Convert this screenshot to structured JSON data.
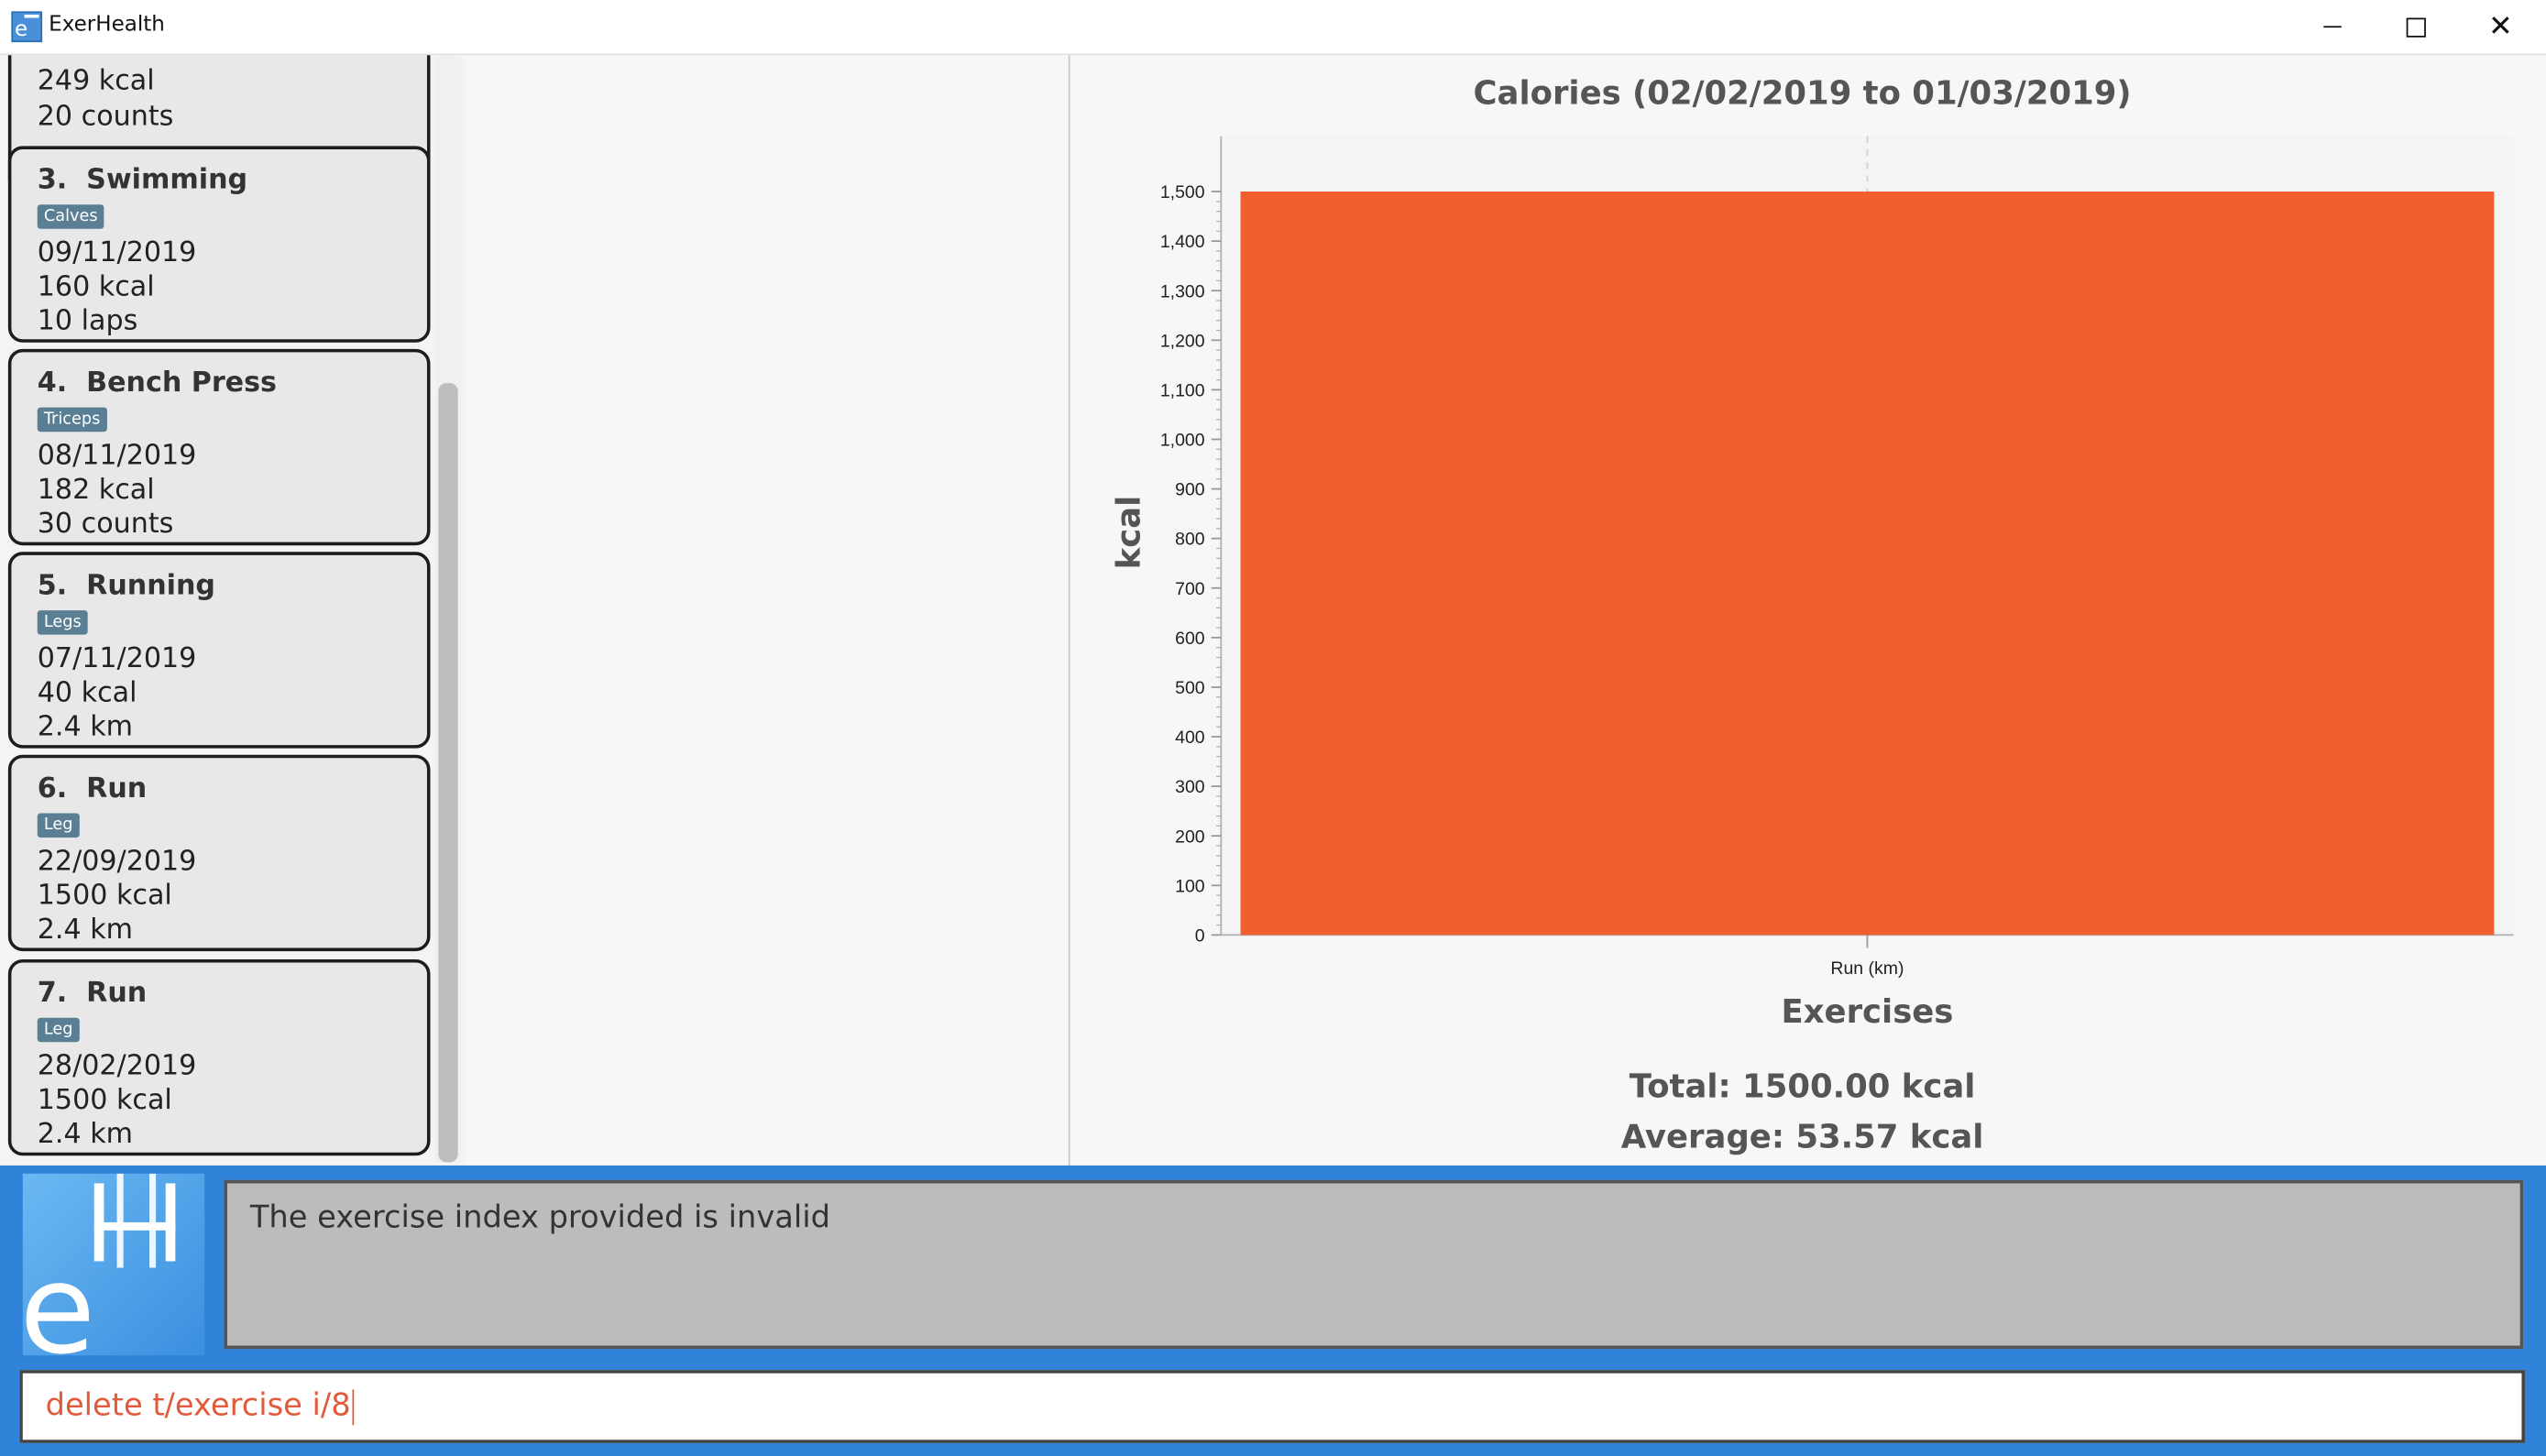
{
  "window": {
    "title": "ExerHealth"
  },
  "window_controls": {
    "minimize": "",
    "maximize": "",
    "close": "✕"
  },
  "exercise_list": {
    "partial_card": {
      "calories": "249 kcal",
      "quantity": "20 counts"
    },
    "items": [
      {
        "index": "3.",
        "name": "Swimming",
        "tag": "Calves",
        "date": "09/11/2019",
        "calories": "160 kcal",
        "quantity": "10 laps"
      },
      {
        "index": "4.",
        "name": "Bench Press",
        "tag": "Triceps",
        "date": "08/11/2019",
        "calories": "182 kcal",
        "quantity": "30 counts"
      },
      {
        "index": "5.",
        "name": "Running",
        "tag": "Legs",
        "date": "07/11/2019",
        "calories": "40 kcal",
        "quantity": "2.4 km"
      },
      {
        "index": "6.",
        "name": "Run",
        "tag": "Leg",
        "date": "22/09/2019",
        "calories": "1500 kcal",
        "quantity": "2.4 km"
      },
      {
        "index": "7.",
        "name": "Run",
        "tag": "Leg",
        "date": "28/02/2019",
        "calories": "1500 kcal",
        "quantity": "2.4 km"
      }
    ]
  },
  "colors": {
    "bar": "#f05f2e",
    "accent": "#2f83d8",
    "tag": "#5a7f94",
    "command_text": "#e15a3b"
  },
  "chart_data": {
    "type": "bar",
    "title": "Calories (02/02/2019 to 01/03/2019)",
    "xlabel": "Exercises",
    "ylabel": "kcal",
    "categories": [
      "Run (km)"
    ],
    "values": [
      1500
    ],
    "ylim": [
      0,
      1500
    ],
    "yticks": [
      "0",
      "100",
      "200",
      "300",
      "400",
      "500",
      "600",
      "700",
      "800",
      "900",
      "1,000",
      "1,100",
      "1,200",
      "1,300",
      "1,400",
      "1,500"
    ],
    "grid": true
  },
  "stats": {
    "total": "Total: 1500.00 kcal",
    "average": "Average: 53.57 kcal"
  },
  "result": {
    "message": "The exercise index provided is invalid"
  },
  "command": {
    "value": "delete t/exercise i/8"
  }
}
